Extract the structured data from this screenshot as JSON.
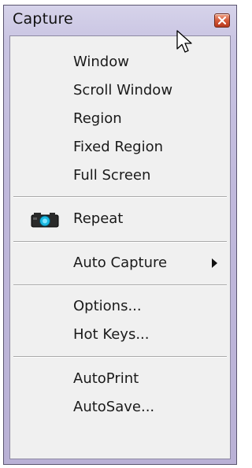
{
  "window": {
    "title": "Capture"
  },
  "icons": {
    "close": "close-icon",
    "repeat": "camera-icon",
    "submenu": "chevron-right-icon",
    "cursor": "mouse-pointer-icon"
  },
  "menu": {
    "window": "Window",
    "scroll_window": "Scroll Window",
    "region": "Region",
    "fixed_region": "Fixed Region",
    "full_screen": "Full Screen",
    "repeat": "Repeat",
    "auto_capture": "Auto Capture",
    "options": "Options...",
    "hot_keys": "Hot Keys...",
    "auto_print": "AutoPrint",
    "auto_save": "AutoSave..."
  },
  "colors": {
    "title_bar": "#c0b9dc",
    "menu_background": "#f0f0f0",
    "close_button": "#d55a3a",
    "camera_lens": "#1ab8e0"
  }
}
